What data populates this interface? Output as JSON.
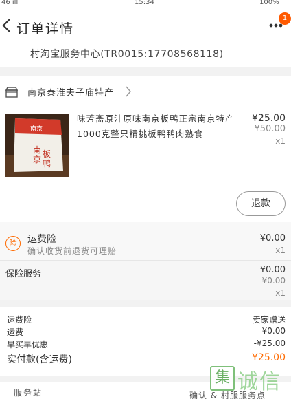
{
  "status_bar": {
    "left": "46 ill",
    "center": "15:34",
    "right": "100%"
  },
  "nav": {
    "title": "订单详情",
    "badge": "1"
  },
  "service_center": {
    "text": "村淘宝服务中心(TR0015:17708568118)"
  },
  "shop": {
    "name": "南京泰淮夫子庙特产"
  },
  "product": {
    "description": "味芳斋原汁原味南京板鸭正宗南京特产1000克整只精挑板鸭鸭肉熟食",
    "price": "¥25.00",
    "original_price": "¥50.00",
    "quantity": "x1",
    "refund_label": "退款"
  },
  "shipping_insurance": {
    "icon_text": "险",
    "title": "运费险",
    "subtitle": "确认收货前退货可理赔",
    "price": "¥0.00",
    "quantity": "x1"
  },
  "insured_service": {
    "title": "保险服务",
    "price": "¥0.00",
    "original_price": "¥0.00",
    "quantity": "x1"
  },
  "summary": {
    "rows": [
      {
        "label": "运费险",
        "value": "卖家赠送"
      },
      {
        "label": "运费",
        "value": "¥0.00"
      },
      {
        "label": "早买早优惠",
        "value": "-¥25.00"
      },
      {
        "label": "实付款(含运费)",
        "value": "¥25.00"
      }
    ]
  },
  "bottom": {
    "left": "服务站",
    "right": "确认 & 村服服务点"
  },
  "watermark": {
    "logo": "集",
    "text": "诚信"
  },
  "colors": {
    "accent": "#ff6a00",
    "badge": "#ff5a00"
  }
}
